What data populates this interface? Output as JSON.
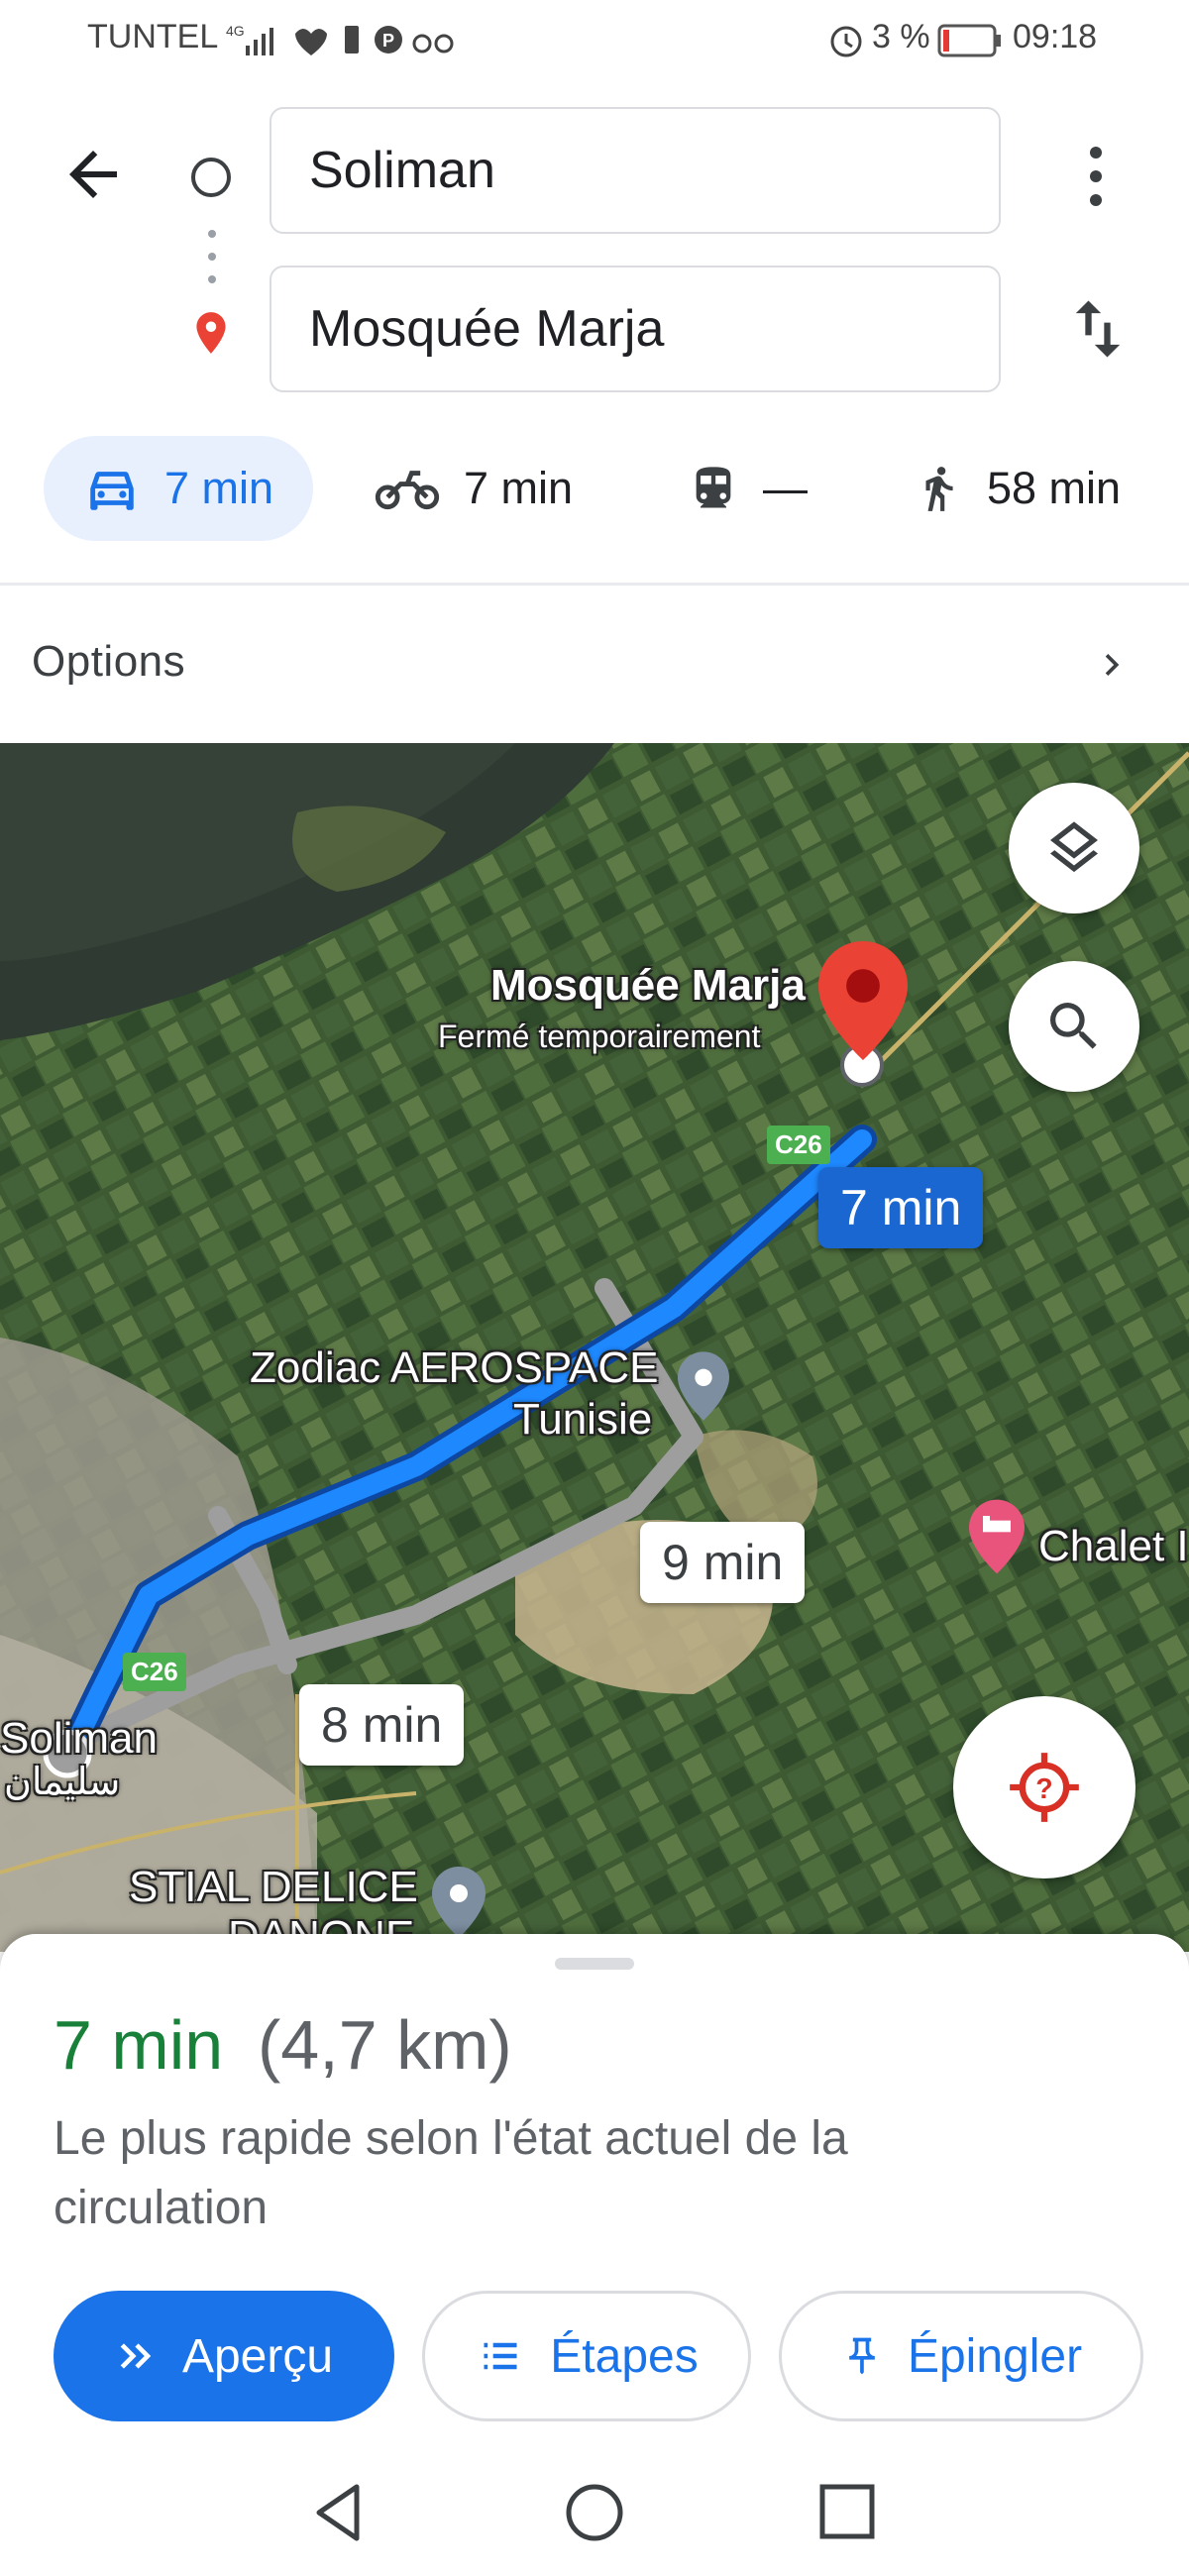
{
  "status_bar": {
    "carrier": "TUNTEL",
    "battery_percent": "3 %",
    "time": "09:18"
  },
  "header": {
    "origin": "Soliman",
    "destination": "Mosquée Marja"
  },
  "travel_modes": [
    {
      "label": "7 min",
      "icon": "car-icon"
    },
    {
      "label": "7 min",
      "icon": "motorcycle-icon"
    },
    {
      "label": "—",
      "icon": "transit-icon"
    },
    {
      "label": "58 min",
      "icon": "walk-icon"
    }
  ],
  "options": {
    "label": "Options"
  },
  "map": {
    "destination_name": "Mosquée Marja",
    "destination_status": "Fermé temporairement",
    "poi_zodiac_line1": "Zodiac AEROSPACE",
    "poi_zodiac_line2": "Tunisie",
    "poi_chalet": "Chalet I",
    "poi_stial_line1": "STIAL DELICE",
    "poi_stial_line2": "DANONE",
    "town_name": "Soliman",
    "town_name_ar": "سليمان",
    "road_code": "C26",
    "route_primary": "7 min",
    "route_alt1": "9 min",
    "route_alt2": "8 min"
  },
  "summary": {
    "duration": "7 min",
    "distance": "(4,7 km)",
    "description": "Le plus rapide selon l'état actuel de la circulation"
  },
  "actions": {
    "overview": "Aperçu",
    "steps": "Étapes",
    "pin": "Épingler"
  },
  "colors": {
    "accent": "#1a73e8",
    "duration_green": "#188038",
    "route_blue": "#1e88ff",
    "destination_red": "#ea4335"
  }
}
